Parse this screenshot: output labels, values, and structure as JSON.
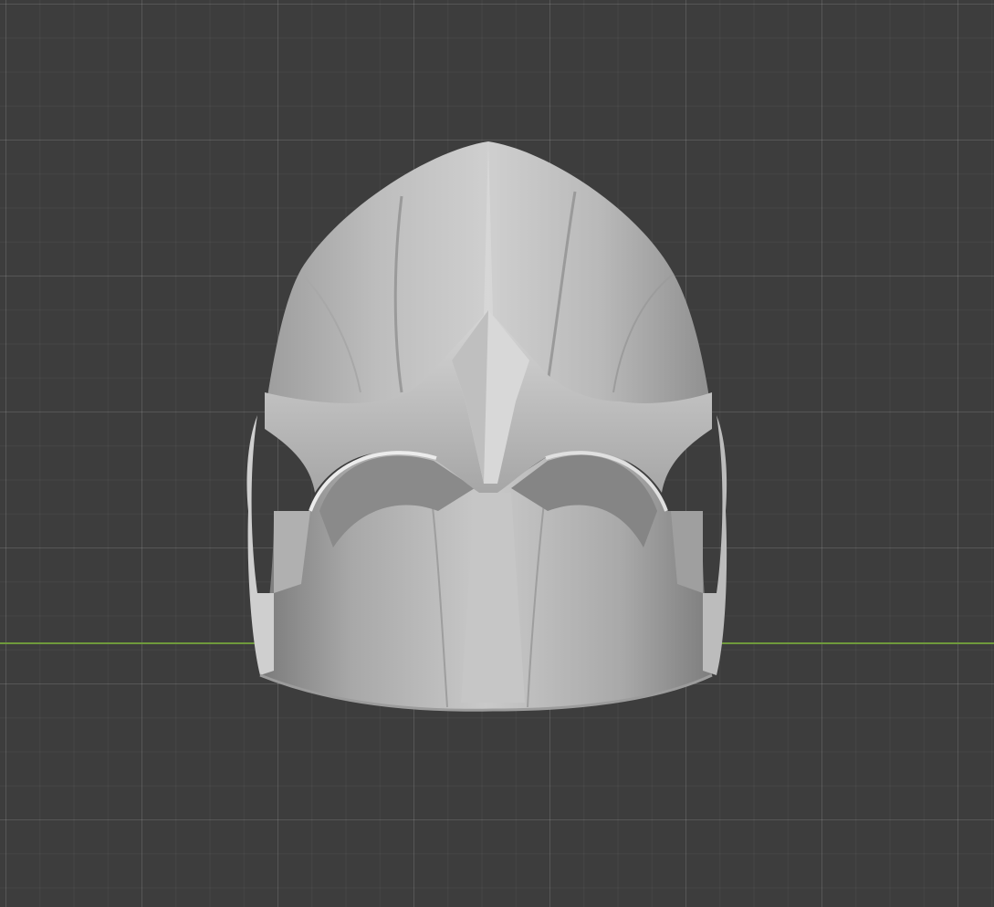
{
  "viewport": {
    "caption": "",
    "background_color": "#3d3d3d",
    "grid_color": "#4a4a4a",
    "x_axis_color": "#6f9a3c"
  },
  "model": {
    "icon": "helmet-icon",
    "base_color": "#c4c4c4",
    "shadow_color": "#8e8e8e",
    "highlight_color": "#e6e6e6"
  }
}
